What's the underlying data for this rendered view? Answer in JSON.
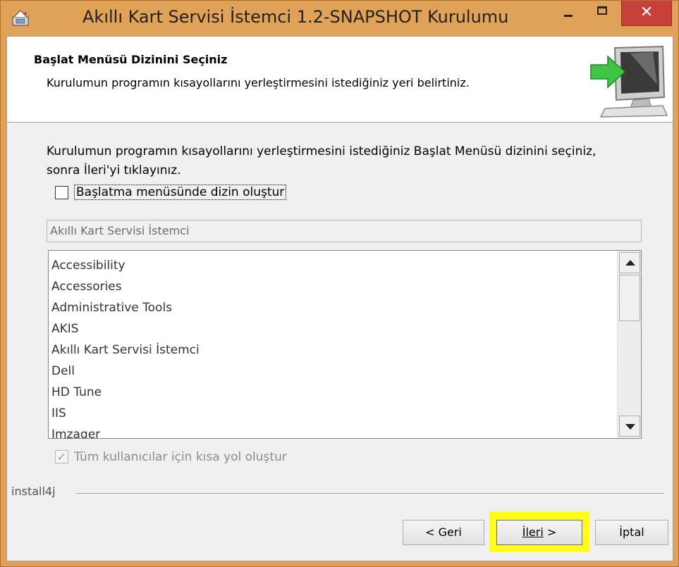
{
  "window": {
    "title": "Akıllı Kart Servisi İstemci 1.2-SNAPSHOT Kurulumu",
    "close_glyph": "✕"
  },
  "header": {
    "title": "Başlat Menüsü Dizinini Seçiniz",
    "subtitle": "Kurulumun programın kısayollarını yerleştirmesini istediğiniz yeri belirtiniz."
  },
  "body": {
    "description": "Kurulumun programın kısayollarını yerleştirmesini istediğiniz Başlat Menüsü dizinini seçiniz, sonra İleri'yi tıklayınız.",
    "create_folder_checkbox": {
      "label": "Başlatma menüsünde dizin oluştur",
      "checked": false
    },
    "folder_name": "Akıllı Kart Servisi İstemci",
    "folder_list": [
      "Accessibility",
      "Accessories",
      "Administrative Tools",
      "AKIS",
      "Akıllı Kart Servisi İstemci",
      "Dell",
      "HD Tune",
      "IIS",
      "Imzager"
    ],
    "all_users_checkbox": {
      "label": "Tüm kullanıcılar için kısa yol oluştur",
      "checked": true,
      "enabled": false,
      "mark": "✓"
    }
  },
  "footer": {
    "brand": "install4j",
    "back_label": "< Geri",
    "next_label": "İleri",
    "next_suffix": " >",
    "cancel_label": "İptal"
  },
  "colors": {
    "frame": "#e0a257",
    "close_button": "#c7403a",
    "highlight": "#fffb1c"
  }
}
